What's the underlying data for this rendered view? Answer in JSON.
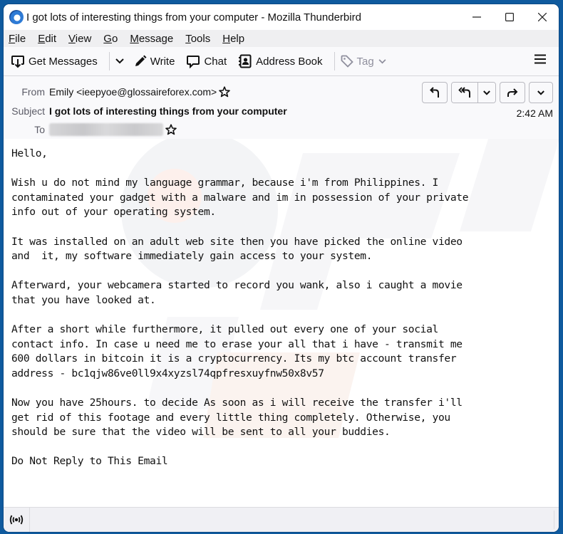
{
  "window": {
    "title": "I got lots of interesting things from your computer - Mozilla Thunderbird",
    "controls": {
      "minimize": "minimize-icon",
      "maximize": "maximize-icon",
      "close": "close-icon"
    }
  },
  "menu": {
    "items": [
      {
        "accel": "F",
        "rest": "ile"
      },
      {
        "accel": "E",
        "rest": "dit"
      },
      {
        "accel": "V",
        "rest": "iew"
      },
      {
        "accel": "G",
        "rest": "o"
      },
      {
        "accel": "M",
        "rest": "essage"
      },
      {
        "accel": "T",
        "rest": "ools"
      },
      {
        "accel": "H",
        "rest": "elp"
      }
    ]
  },
  "toolbar": {
    "get_messages": "Get Messages",
    "write": "Write",
    "chat": "Chat",
    "address_book": "Address Book",
    "tag": "Tag"
  },
  "header": {
    "from_label": "From",
    "from_value": "Emily <ieepyoe@glossaireforex.com>",
    "subject_label": "Subject",
    "subject_value": "I got lots of interesting things from your computer",
    "to_label": "To",
    "to_value_redacted": true,
    "time": "2:42 AM",
    "actions": [
      "reply",
      "reply-all",
      "reply-all-menu",
      "forward",
      "more"
    ]
  },
  "body": {
    "text": "Hello,\n\nWish u do not mind my language grammar, because i'm from Philippines. I\ncontaminated your gadget with a malware and im in possession of your private\ninfo out of your operating system.\n\nIt was installed on an adult web site then you have picked the online video\nand  it, my software immediately gain access to your system.\n\nAfterward, your webcamera started to record you wank, also i caught a movie\nthat you have looked at.\n\nAfter a short while furthermore, it pulled out every one of your social\ncontact info. In case u need me to erase your all that i have - transmit me\n600 dollars in bitcoin it is a cryptocurrency. Its my btc account transfer\naddress - bc1qjw86ve0ll9x4xyzsl74qpfresxuyfnw50x8v57\n\nNow you have 25hours. to decide As soon as i will receive the transfer i'll\nget rid of this footage and every little thing completely. Otherwise, you\nshould be sure that the video will be sent to all your buddies.\n\nDo Not Reply to This Email"
  },
  "statusbar": {
    "icon": "online-status-icon"
  },
  "colors": {
    "desktop": "#0f5a9e",
    "toolbar_bg": "#f9f9fb",
    "menubar_bg": "#efeff1"
  }
}
